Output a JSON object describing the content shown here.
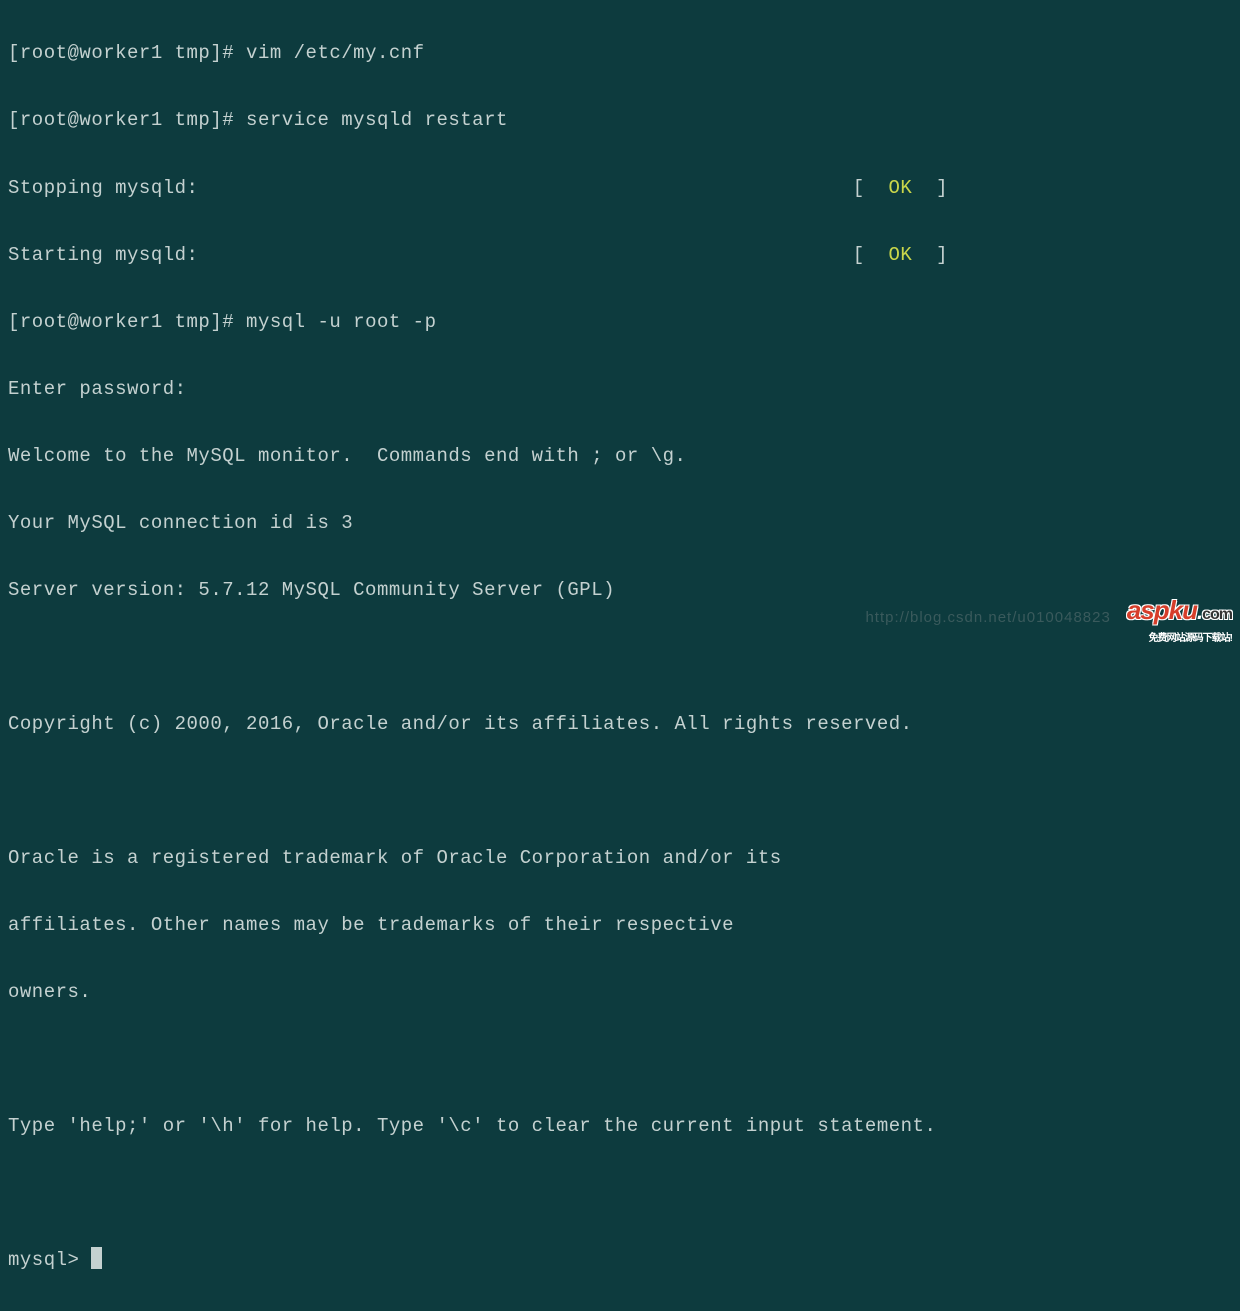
{
  "prompt": "[root@worker1 tmp]# ",
  "commands": {
    "cmd1": "vim /etc/my.cnf",
    "cmd2": "service mysqld restart",
    "cmd3": "mysql -u root -p"
  },
  "status": {
    "stopping": "Stopping mysqld:",
    "starting": "Starting mysqld:",
    "bracket_open": "[  ",
    "ok": "OK",
    "bracket_close": "  ]"
  },
  "mysql": {
    "enter_password": "Enter password:",
    "welcome": "Welcome to the MySQL monitor.  Commands end with ; or \\g.",
    "connection_id": "Your MySQL connection id is 3",
    "server_version": "Server version: 5.7.12 MySQL Community Server (GPL)",
    "copyright": "Copyright (c) 2000, 2016, Oracle and/or its affiliates. All rights reserved.",
    "trademark_1": "Oracle is a registered trademark of Oracle Corporation and/or its",
    "trademark_2": "affiliates. Other names may be trademarks of their respective",
    "trademark_3": "owners.",
    "help": "Type 'help;' or '\\h' for help. Type '\\c' to clear the current input statement.",
    "prompt": "mysql> "
  },
  "watermark": {
    "blog_url": "http://blog.csdn.net/u010048823",
    "logo_main": "aspku",
    "logo_dot": ".",
    "logo_com": "com",
    "logo_tag": "免费网站源码下载站!"
  }
}
